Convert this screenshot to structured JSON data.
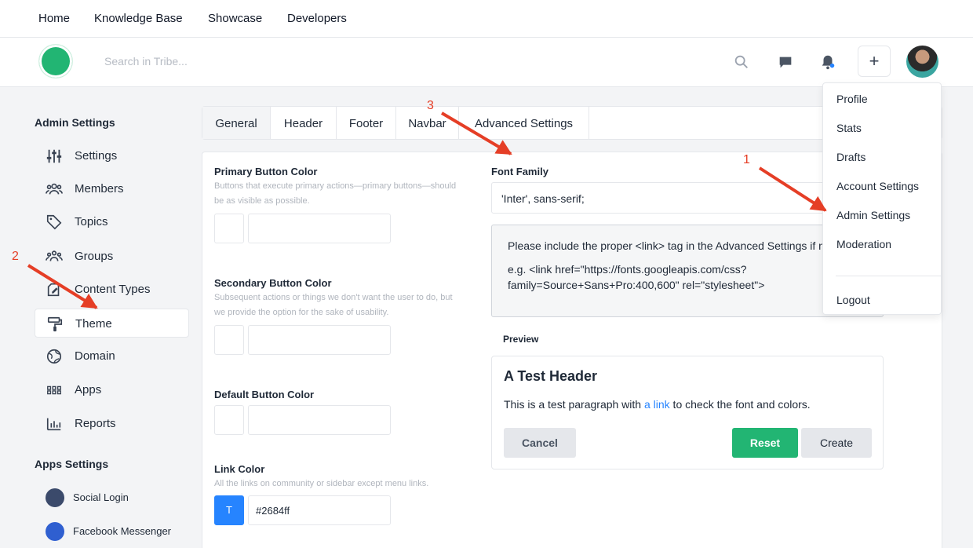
{
  "topnav": {
    "items": [
      "Home",
      "Knowledge Base",
      "Showcase",
      "Developers"
    ]
  },
  "header": {
    "search_placeholder": "Search in Tribe...",
    "plus_label": "+"
  },
  "sidebar": {
    "admin_heading": "Admin Settings",
    "admin_items": [
      {
        "label": "Settings",
        "icon": "sliders-icon"
      },
      {
        "label": "Members",
        "icon": "users-icon"
      },
      {
        "label": "Topics",
        "icon": "tag-icon"
      },
      {
        "label": "Groups",
        "icon": "groups-icon"
      },
      {
        "label": "Content Types",
        "icon": "edit-icon"
      },
      {
        "label": "Theme",
        "icon": "paint-roller-icon"
      },
      {
        "label": "Domain",
        "icon": "globe-icon"
      },
      {
        "label": "Apps",
        "icon": "grid-icon"
      },
      {
        "label": "Reports",
        "icon": "bar-chart-icon"
      }
    ],
    "apps_heading": "Apps Settings",
    "apps_items": [
      {
        "label": "Social Login",
        "color": "#3b4a6b"
      },
      {
        "label": "Facebook Messenger",
        "color": "#2f5fd0"
      }
    ]
  },
  "tabs": [
    "General",
    "Header",
    "Footer",
    "Navbar",
    "Advanced Settings"
  ],
  "form": {
    "primary": {
      "label": "Primary Button Color",
      "desc": "Buttons that execute primary actions—primary buttons—should be as visible as possible."
    },
    "secondary": {
      "label": "Secondary Button Color",
      "desc": "Subsequent actions or things we don't want the user to do, but we provide the option for the sake of usability."
    },
    "default": {
      "label": "Default Button Color"
    },
    "link": {
      "label": "Link Color",
      "desc": "All the links on community or sidebar except menu links.",
      "value": "#2684ff",
      "swatch_letter": "T"
    },
    "font_family": {
      "label": "Font Family",
      "value": "'Inter', sans-serif;"
    },
    "note": {
      "line1": "Please include the proper <link> tag in the Advanced Settings if needed.",
      "line2": "e.g. <link href=\"https://fonts.googleapis.com/css?family=Source+Sans+Pro:400,600\" rel=\"stylesheet\">"
    }
  },
  "preview": {
    "label": "Preview",
    "title": "A Test Header",
    "text_before": "This is a test paragraph with ",
    "link_text": "a link",
    "text_after": " to check the font and colors.",
    "cancel": "Cancel",
    "reset": "Reset",
    "create": "Create"
  },
  "dropdown": {
    "items": [
      "Profile",
      "Stats",
      "Drafts",
      "Account Settings",
      "Admin Settings",
      "Moderation"
    ],
    "logout": "Logout"
  },
  "annotations": [
    "1",
    "2",
    "3"
  ],
  "colors": {
    "accent": "#22b573",
    "link": "#2684ff",
    "arrow": "#e53e26"
  }
}
